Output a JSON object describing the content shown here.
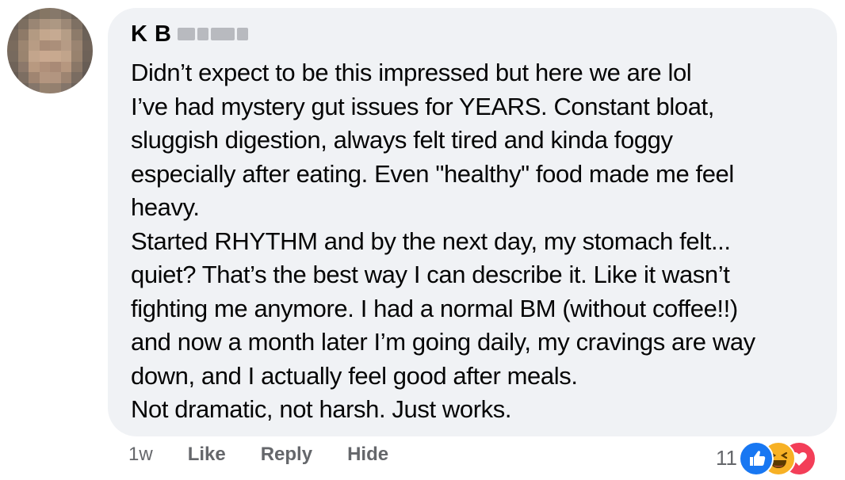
{
  "comment": {
    "author_initials": "K B",
    "text_lines": [
      "Didn’t expect to be this impressed but here we are lol",
      "I’ve had mystery gut issues for YEARS. Constant bloat,",
      "sluggish digestion, always felt tired and kinda foggy",
      "especially after eating. Even \"healthy\" food made me feel",
      "heavy.",
      "Started RHYTHM and by the next day, my stomach felt...",
      "quiet? That’s the best way I can describe it. Like it wasn’t",
      "fighting me anymore. I had a normal BM (without coffee!!)",
      "and now a month later I’m going daily, my cravings are way",
      "down, and I actually feel good after meals.",
      "Not dramatic, not harsh. Just works."
    ]
  },
  "actions": {
    "timestamp": "1w",
    "like_label": "Like",
    "reply_label": "Reply",
    "hide_label": "Hide"
  },
  "reactions": {
    "count": "11",
    "icons": [
      "like-icon",
      "haha-icon",
      "love-icon"
    ]
  },
  "colors": {
    "bubble_bg": "#f0f2f5",
    "text": "#050505",
    "secondary_text": "#65676b",
    "like_blue": "#1877f2",
    "haha_yellow": "#f7b125",
    "love_red": "#f33e58"
  }
}
